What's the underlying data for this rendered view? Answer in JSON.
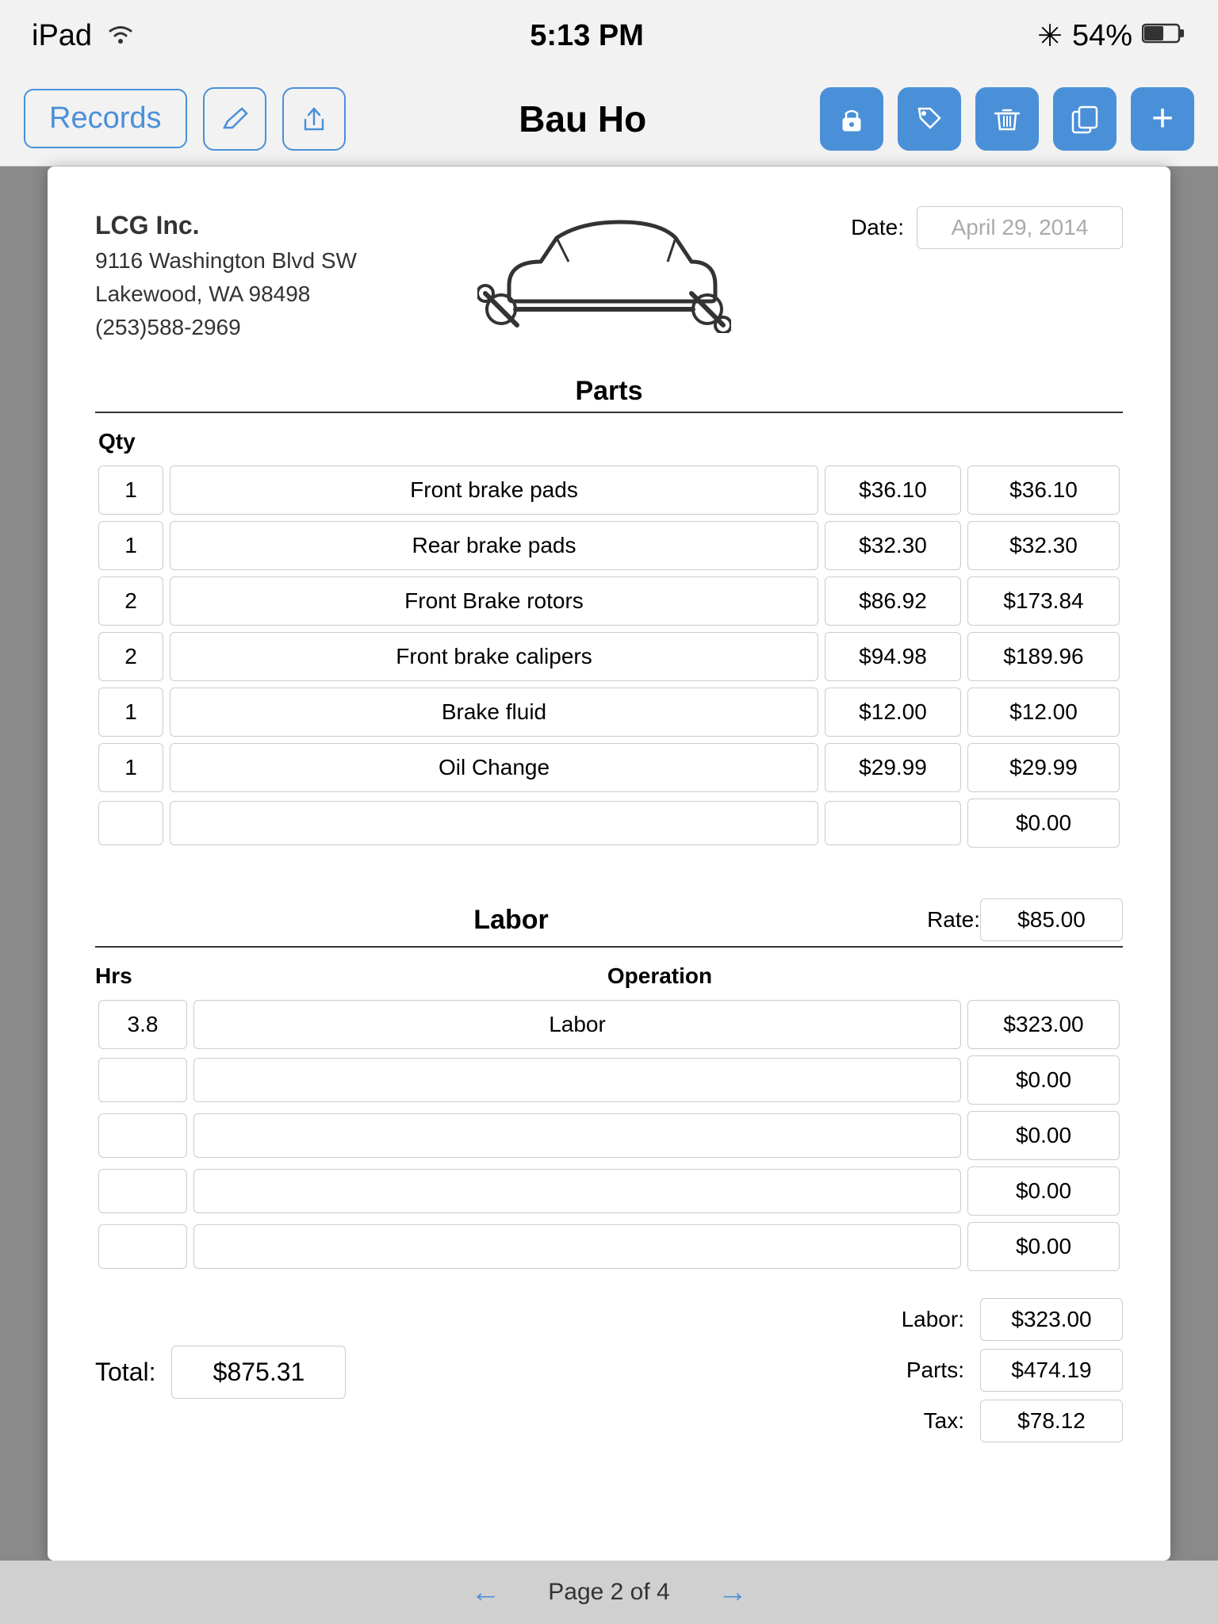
{
  "statusBar": {
    "device": "iPad",
    "wifi": "WiFi",
    "time": "5:13 PM",
    "bluetooth": "BT",
    "battery": "54%"
  },
  "toolbar": {
    "recordsLabel": "Records",
    "pageTitle": "Bau Ho",
    "icons": {
      "edit": "✏️",
      "share": "↑",
      "lock": "🔒",
      "tag": "🏷",
      "trash": "🗑",
      "copy": "📋",
      "add": "+"
    }
  },
  "document": {
    "company": {
      "name": "LCG Inc.",
      "address1": "9116 Washington Blvd SW",
      "address2": "Lakewood, WA  98498",
      "phone": "(253)588-2969"
    },
    "date": {
      "label": "Date:",
      "value": "April 29, 2014"
    },
    "partsSection": {
      "title": "Parts",
      "qtyHeader": "Qty",
      "rows": [
        {
          "qty": "1",
          "description": "Front brake pads",
          "unitPrice": "$36.10",
          "total": "$36.10"
        },
        {
          "qty": "1",
          "description": "Rear brake pads",
          "unitPrice": "$32.30",
          "total": "$32.30"
        },
        {
          "qty": "2",
          "description": "Front Brake rotors",
          "unitPrice": "$86.92",
          "total": "$173.84"
        },
        {
          "qty": "2",
          "description": "Front brake calipers",
          "unitPrice": "$94.98",
          "total": "$189.96"
        },
        {
          "qty": "1",
          "description": "Brake fluid",
          "unitPrice": "$12.00",
          "total": "$12.00"
        },
        {
          "qty": "1",
          "description": "Oil Change",
          "unitPrice": "$29.99",
          "total": "$29.99"
        },
        {
          "qty": "",
          "description": "",
          "unitPrice": "",
          "total": "$0.00"
        }
      ]
    },
    "laborSection": {
      "title": "Labor",
      "rateLabel": "Rate:",
      "rateValue": "$85.00",
      "hrsHeader": "Hrs",
      "opHeader": "Operation",
      "rows": [
        {
          "hrs": "3.8",
          "operation": "Labor",
          "cost": "$323.00"
        },
        {
          "hrs": "",
          "operation": "",
          "cost": "$0.00"
        },
        {
          "hrs": "",
          "operation": "",
          "cost": "$0.00"
        },
        {
          "hrs": "",
          "operation": "",
          "cost": "$0.00"
        },
        {
          "hrs": "",
          "operation": "",
          "cost": "$0.00"
        }
      ]
    },
    "summary": {
      "totalLabel": "Total:",
      "totalValue": "$875.31",
      "laborLabel": "Labor:",
      "laborValue": "$323.00",
      "partsLabel": "Parts:",
      "partsValue": "$474.19",
      "taxLabel": "Tax:",
      "taxValue": "$78.12"
    }
  },
  "pagination": {
    "text": "Page 2 of 4",
    "prevArrow": "←",
    "nextArrow": "→"
  }
}
